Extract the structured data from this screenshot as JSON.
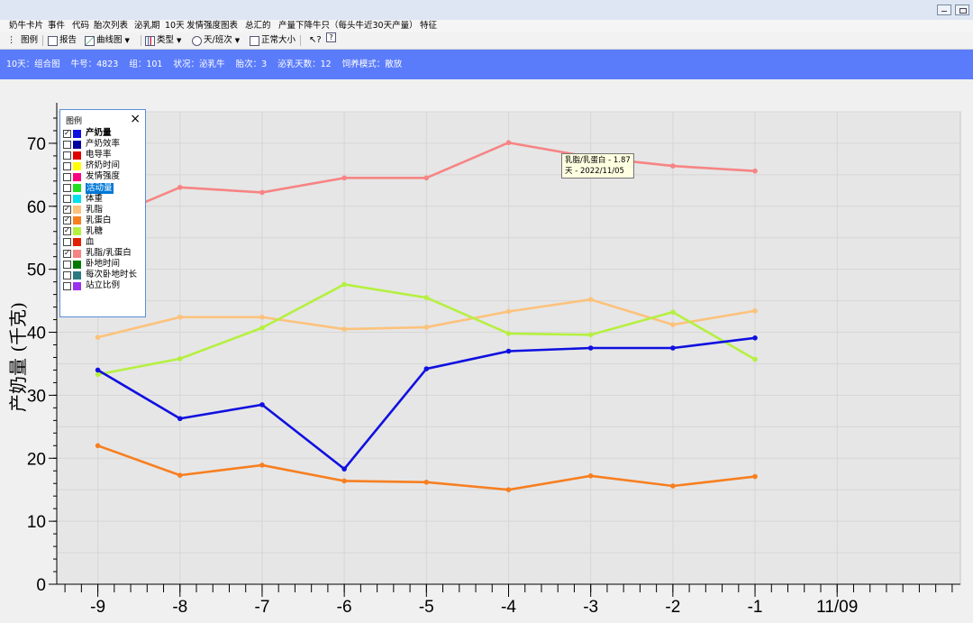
{
  "menu": [
    "奶牛卡片",
    "事件",
    "代码",
    "胎次列表",
    "泌乳期",
    "10天",
    "发情强度图表",
    "总汇的",
    "产量下降牛只（每头牛近30天产量）",
    "特征"
  ],
  "toolbar": {
    "legend": "图例",
    "report": "报告",
    "curve": "曲线图",
    "type": "类型",
    "day_shift": "天/班次",
    "normal_size": "正常大小"
  },
  "status": {
    "view": "10天：组合图",
    "cow_no": "牛号：4823",
    "group": "组：101",
    "state": "状况：泌乳牛",
    "parity": "胎次：3",
    "dim": "泌乳天数：12",
    "housing": "饲养模式：散放"
  },
  "legend": {
    "title": "图例",
    "close": "×",
    "items": [
      {
        "label": "产奶量",
        "checked": true,
        "color": "#1010e0",
        "bold": true
      },
      {
        "label": "产奶效率",
        "checked": false,
        "color": "#0000a0"
      },
      {
        "label": "电导率",
        "checked": false,
        "color": "#e00000"
      },
      {
        "label": "挤奶时间",
        "checked": false,
        "color": "#ffff00"
      },
      {
        "label": "发情强度",
        "checked": false,
        "color": "#ff0080"
      },
      {
        "label": "活动量",
        "checked": false,
        "color": "#20e020",
        "highlight": true
      },
      {
        "label": "体重",
        "checked": false,
        "color": "#00e0f0"
      },
      {
        "label": "乳脂",
        "checked": true,
        "color": "#fcc27c"
      },
      {
        "label": "乳蛋白",
        "checked": true,
        "color": "#f77f20"
      },
      {
        "label": "乳糖",
        "checked": true,
        "color": "#b5f040"
      },
      {
        "label": "血",
        "checked": false,
        "color": "#e02000"
      },
      {
        "label": "乳脂/乳蛋白",
        "checked": true,
        "color": "#f78484"
      },
      {
        "label": "卧地时间",
        "checked": false,
        "color": "#007a00"
      },
      {
        "label": "每次卧地时长",
        "checked": false,
        "color": "#2a7a80"
      },
      {
        "label": "站立比例",
        "checked": false,
        "color": "#9b30f0"
      }
    ]
  },
  "tooltip": {
    "line1": "乳脂/乳蛋白 - 1.87",
    "line2": "天 - 2022/11/05"
  },
  "chart_data": {
    "type": "line",
    "ylabel": "产奶量 (千克)",
    "ylim": [
      0,
      75
    ],
    "yticks": [
      0,
      10,
      20,
      30,
      40,
      50,
      60,
      70
    ],
    "xlim": [
      -9.5,
      1.5
    ],
    "x": [
      -9,
      -8,
      -7,
      -6,
      -5,
      -4,
      -3,
      -2,
      -1
    ],
    "xtick_labels": [
      "-9",
      "-8",
      "-7",
      "-6",
      "-5",
      "-4",
      "-3",
      "-2",
      "-1",
      "11/09"
    ],
    "xtick_values": [
      -9,
      -8,
      -7,
      -6,
      -5,
      -4,
      -3,
      -2,
      -1,
      0
    ],
    "grid": true,
    "series": [
      {
        "name": "乳脂/乳蛋白",
        "color": "#f78484",
        "values": [
          57.5,
          63.0,
          62.2,
          64.5,
          64.5,
          70.1,
          67.8,
          66.4,
          65.6
        ]
      },
      {
        "name": "乳脂",
        "color": "#fcc27c",
        "values": [
          39.2,
          42.4,
          42.4,
          40.5,
          40.8,
          43.3,
          45.2,
          41.2,
          43.4
        ]
      },
      {
        "name": "乳糖",
        "color": "#b5f040",
        "values": [
          33.3,
          35.8,
          40.7,
          47.6,
          45.5,
          39.8,
          39.6,
          43.2,
          35.7
        ]
      },
      {
        "name": "产奶量",
        "color": "#1010e0",
        "values": [
          34.0,
          26.3,
          28.5,
          18.3,
          34.2,
          37.0,
          37.5,
          37.5,
          39.1
        ]
      },
      {
        "name": "乳蛋白",
        "color": "#f77f20",
        "values": [
          22.0,
          17.3,
          18.9,
          16.4,
          16.2,
          15.0,
          17.2,
          15.6,
          17.1
        ]
      }
    ]
  }
}
